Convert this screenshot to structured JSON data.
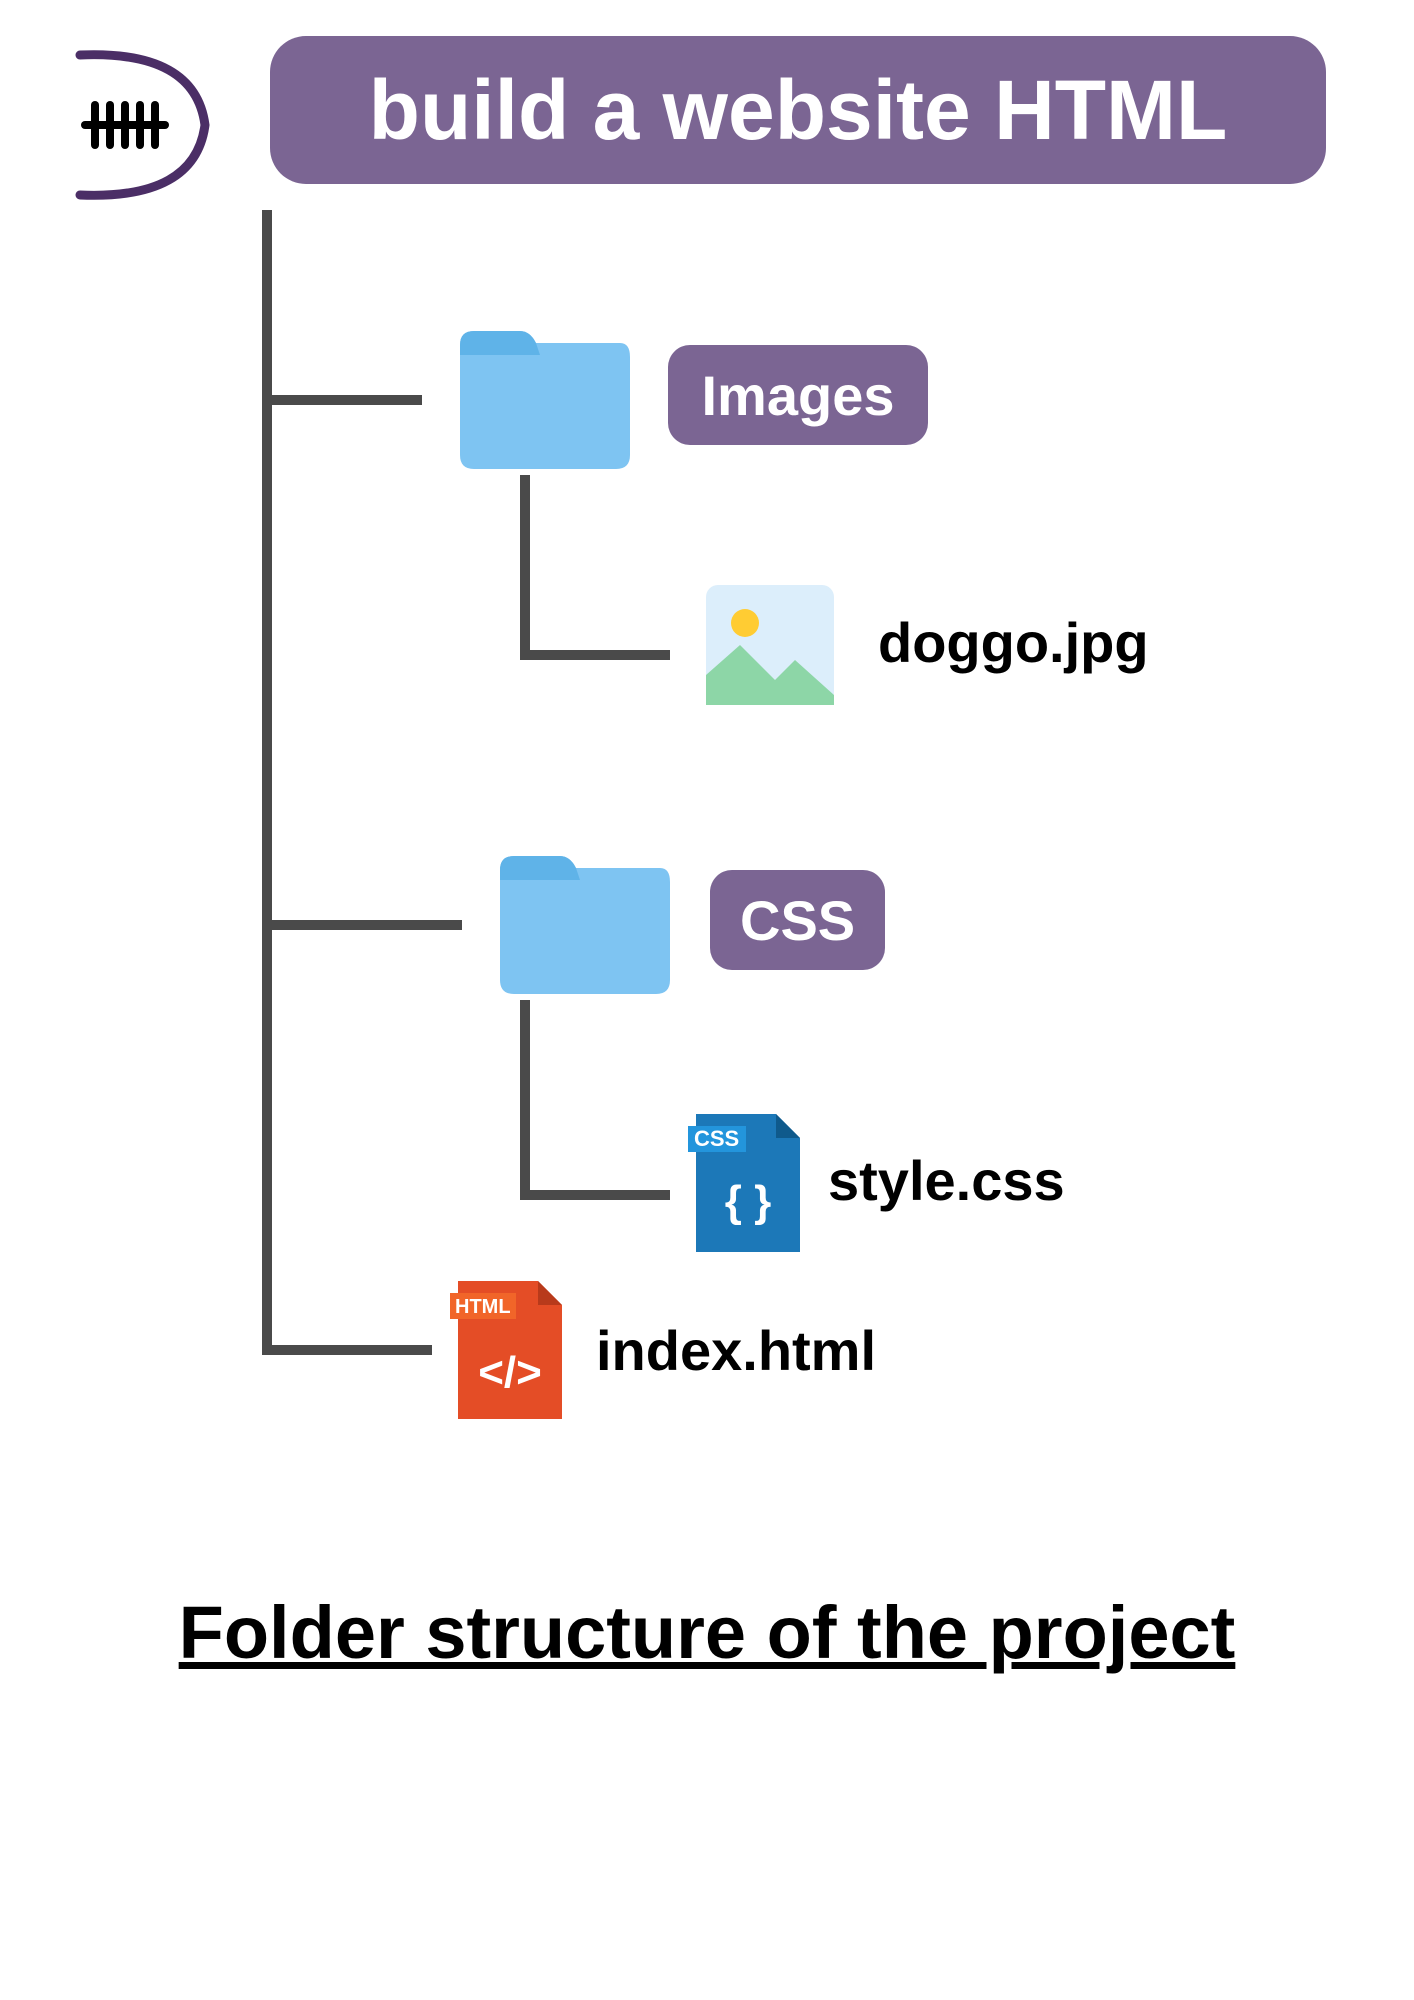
{
  "root": {
    "title": "build a website HTML"
  },
  "folders": {
    "images": {
      "label": "Images"
    },
    "css": {
      "label": "CSS"
    }
  },
  "files": {
    "doggo": {
      "label": "doggo.jpg"
    },
    "style": {
      "label": "style.css",
      "badge": "CSS"
    },
    "index": {
      "label": "index.html",
      "badge": "HTML"
    }
  },
  "caption": "Folder structure of the project",
  "colors": {
    "purple": "#7B6593",
    "folderBlue": "#7EC4F2",
    "lineGray": "#4a4a4a",
    "cssBlue1": "#1C78B8",
    "cssBlue2": "#2395DC",
    "htmlOrange1": "#E44D26",
    "htmlOrange2": "#F16529",
    "imgBg": "#DCEEFB",
    "imgSun": "#FFCC33",
    "imgHill": "#8DD6A7"
  }
}
